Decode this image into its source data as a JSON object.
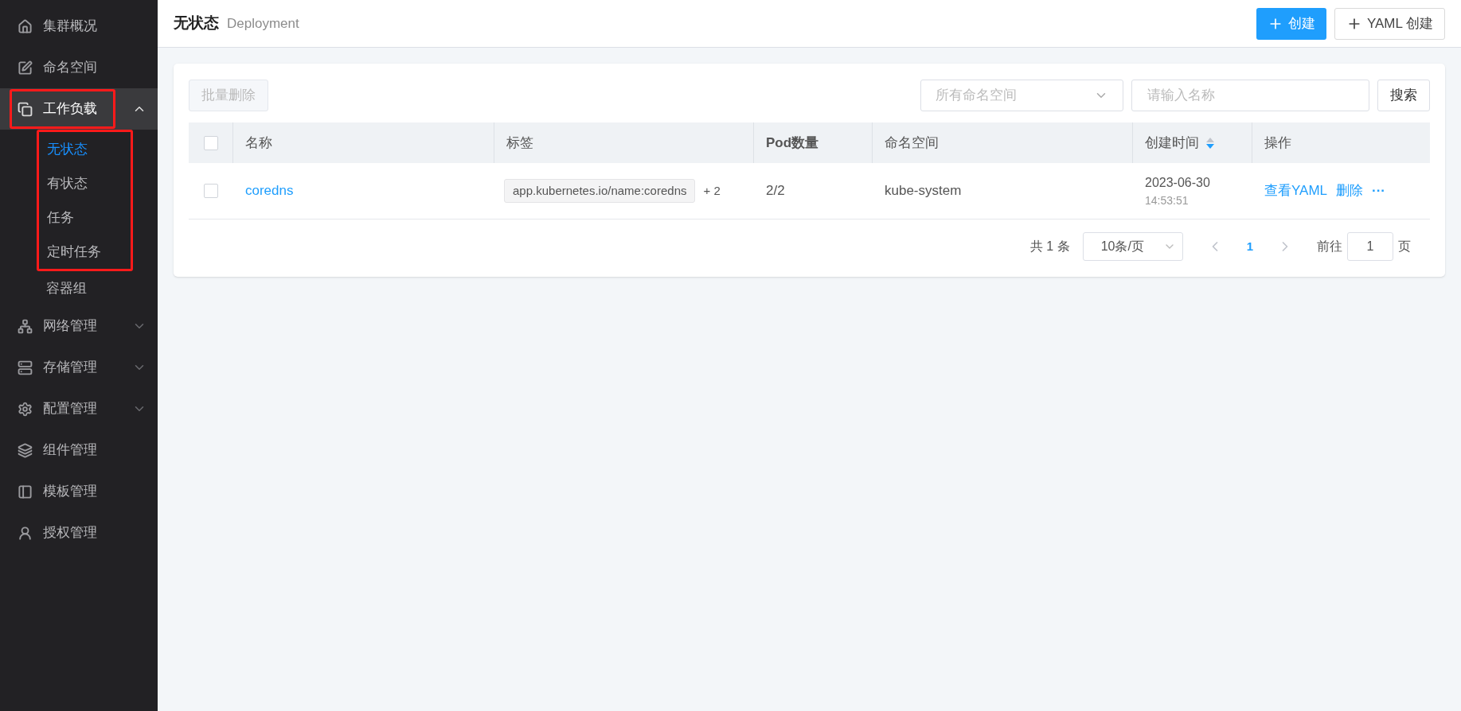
{
  "sidebar": {
    "items": [
      {
        "label": "集群概况",
        "selected": false,
        "annotated": false
      },
      {
        "label": "命名空间",
        "selected": false,
        "annotated": false
      },
      {
        "label": "工作负载",
        "selected": true,
        "expanded": true,
        "annotated": true,
        "children": [
          {
            "label": "无状态",
            "selected": true,
            "annotated": true
          },
          {
            "label": "有状态",
            "selected": false,
            "annotated": true
          },
          {
            "label": "任务",
            "selected": false,
            "annotated": true
          },
          {
            "label": "定时任务",
            "selected": false,
            "annotated": true
          },
          {
            "label": "容器组",
            "selected": false,
            "annotated": false
          }
        ]
      },
      {
        "label": "网络管理",
        "selected": false,
        "expanded": false,
        "annotated": false
      },
      {
        "label": "存储管理",
        "selected": false,
        "expanded": false,
        "annotated": false
      },
      {
        "label": "配置管理",
        "selected": false,
        "expanded": false,
        "annotated": false
      },
      {
        "label": "组件管理",
        "selected": false,
        "annotated": false
      },
      {
        "label": "模板管理",
        "selected": false,
        "annotated": false
      },
      {
        "label": "授权管理",
        "selected": false,
        "annotated": false
      }
    ]
  },
  "header": {
    "title": "无状态",
    "subtitle": "Deployment",
    "buttons": [
      {
        "label": "创建",
        "kind": "primary"
      },
      {
        "label": "YAML 创建",
        "kind": "default"
      }
    ]
  },
  "toolbar": {
    "bulk_delete": {
      "label": "批量删除",
      "disabled": true
    },
    "namespace_select": {
      "placeholder": "所有命名空间"
    },
    "search": {
      "placeholder": "请输入名称"
    },
    "search_button": "搜索"
  },
  "table": {
    "select_all_checked": false,
    "columns": [
      "名称",
      "标签",
      "Pod数量",
      "命名空间",
      "创建时间",
      "操作"
    ],
    "rows": [
      {
        "checked": false,
        "name": "coredns",
        "tag": "app.kubernetes.io/name:coredns",
        "more_tags": "+ 2",
        "pods": "2/2",
        "namespace": "kube-system",
        "date": "2023-06-30",
        "time": "14:53:51",
        "actions": [
          "查看YAML",
          "删除"
        ],
        "more": "···"
      }
    ]
  },
  "pagination": {
    "total": "共 1 条",
    "page_size": "10条/页",
    "pages": [
      {
        "label": "1",
        "selected": true
      }
    ],
    "goto_label": "前往",
    "goto_value": "1",
    "goto_suffix": "页"
  }
}
